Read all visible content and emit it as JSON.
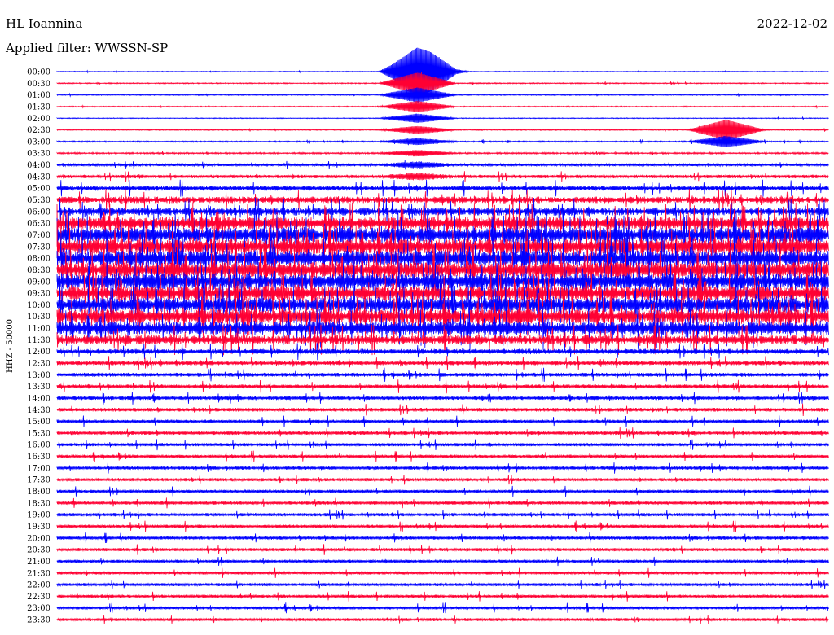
{
  "header": {
    "station": "HL Ioannina",
    "filter": "Applied filter: WWSSN-SP",
    "date": "2022-12-02"
  },
  "chart_data": {
    "type": "line",
    "title": "HL Ioannina",
    "subtitle": "Applied filter: WWSSN-SP",
    "date": "2022-12-02",
    "ylabel": "HHZ - 50000",
    "colors": [
      "#0000ff",
      "#ff0033"
    ],
    "line_minutes": 30,
    "categories": [
      "00:00",
      "00:30",
      "01:00",
      "01:30",
      "02:00",
      "02:30",
      "03:00",
      "03:30",
      "04:00",
      "04:30",
      "05:00",
      "05:30",
      "06:00",
      "06:30",
      "07:00",
      "07:30",
      "08:00",
      "08:30",
      "09:00",
      "09:30",
      "10:00",
      "10:30",
      "11:00",
      "11:30",
      "12:00",
      "12:30",
      "13:00",
      "13:30",
      "14:00",
      "14:30",
      "15:00",
      "15:30",
      "16:00",
      "16:30",
      "17:00",
      "17:30",
      "18:00",
      "18:30",
      "19:00",
      "19:30",
      "20:00",
      "20:30",
      "21:00",
      "21:30",
      "22:00",
      "22:30",
      "23:00",
      "23:30"
    ],
    "noise_level": [
      0.15,
      0.2,
      0.2,
      0.2,
      0.15,
      0.2,
      0.25,
      0.3,
      0.5,
      0.7,
      1.0,
      1.3,
      1.6,
      2.4,
      2.8,
      3.0,
      3.0,
      3.0,
      3.0,
      2.8,
      2.8,
      2.8,
      2.6,
      1.8,
      1.0,
      0.85,
      0.8,
      0.8,
      0.75,
      0.75,
      0.7,
      0.7,
      0.65,
      0.65,
      0.65,
      0.65,
      0.65,
      0.65,
      0.65,
      0.65,
      0.65,
      0.65,
      0.6,
      0.6,
      0.6,
      0.6,
      0.6,
      0.6
    ],
    "events": [
      {
        "line": "00:00",
        "minute": 14,
        "amplitude": 6,
        "color": "red",
        "duration_lines": 10
      },
      {
        "line": "02:30",
        "minute": 26,
        "amplitude": 3,
        "color": "blue",
        "duration_lines": 2
      },
      {
        "line": "00:00",
        "minute": 14.5,
        "amplitude": 2,
        "color": "blue",
        "duration_lines": 1
      }
    ]
  }
}
